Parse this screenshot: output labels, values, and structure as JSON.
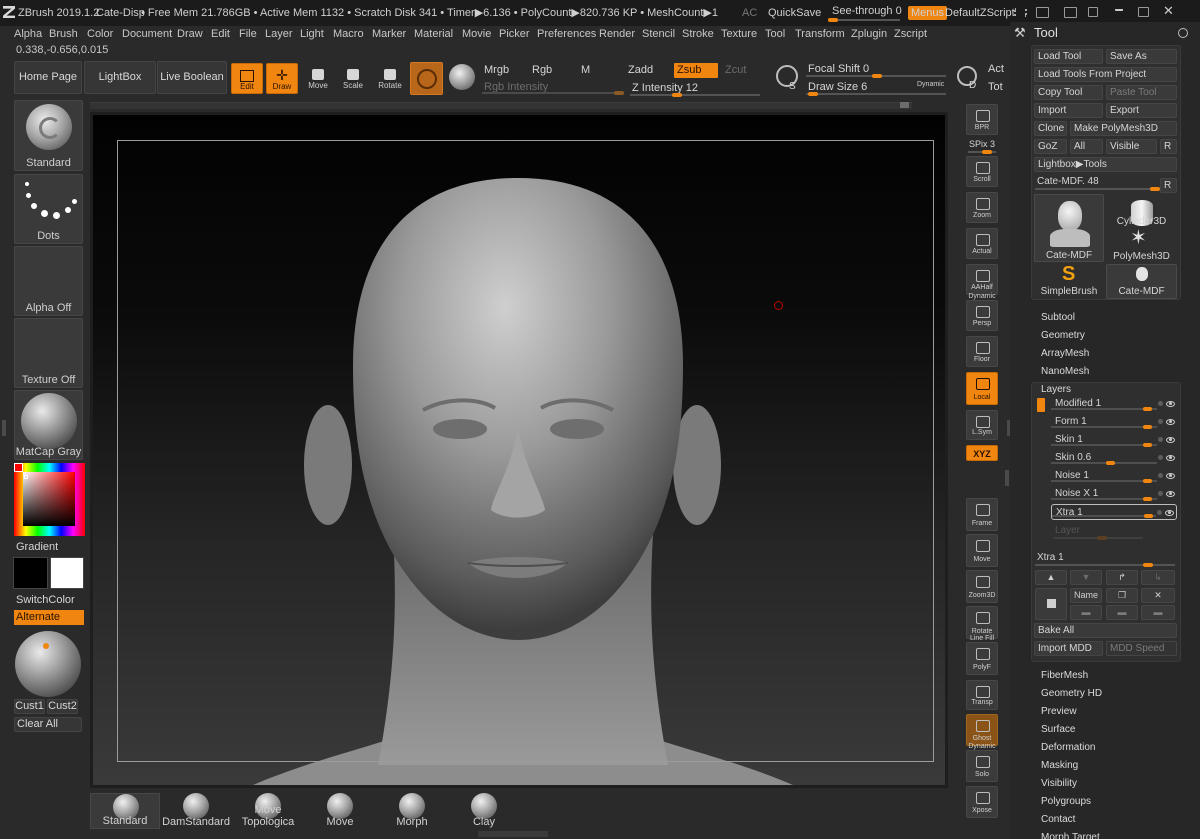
{
  "titlebar": {
    "app": "ZBrush 2019.1.2",
    "document": "Cate-Disp",
    "stats": "• Free Mem 21.786GB • Active Mem 1132 • Scratch Disk 341 • Timer▶6.136 • PolyCount▶820.736 KP • MeshCount▶1",
    "ac": "AC",
    "quicksave": "QuickSave",
    "see_through": "See-through  0",
    "see_through_value": 0,
    "menus": "Menus",
    "script": "DefaultZScript"
  },
  "menubar": [
    "Alpha",
    "Brush",
    "Color",
    "Document",
    "Draw",
    "Edit",
    "File",
    "Layer",
    "Light",
    "Macro",
    "Marker",
    "Material",
    "Movie",
    "Picker",
    "Preferences",
    "Render",
    "Stencil",
    "Stroke",
    "Texture",
    "Tool",
    "Transform",
    "Zplugin",
    "Zscript"
  ],
  "coords": "0.338,-0.656,0.015",
  "topshelf": {
    "home": "Home Page",
    "lightbox": "LightBox",
    "live_boolean": "Live Boolean",
    "edit": "Edit",
    "draw": "Draw",
    "move": "Move",
    "scale": "Scale",
    "rotate": "Rotate",
    "mrgb": "Mrgb",
    "rgb": "Rgb",
    "m": "M",
    "rgb_intensity": "Rgb Intensity",
    "zadd": "Zadd",
    "zsub": "Zsub",
    "zcut": "Zcut",
    "z_intensity": "Z Intensity 12",
    "focal_shift": "Focal Shift 0",
    "draw_size": "Draw Size 6",
    "dynamic": "Dynamic",
    "act": "Act",
    "tot": "Tot",
    "s_letter": "S",
    "d_letter": "D"
  },
  "leftshelf": {
    "brush": "Standard",
    "stroke": "Dots",
    "alpha": "Alpha Off",
    "texture": "Texture Off",
    "material": "MatCap Gray",
    "gradient": "Gradient",
    "switchcolor": "SwitchColor",
    "alternate": "Alternate",
    "cust1": "Cust1",
    "cust2": "Cust2",
    "clearall": "Clear All"
  },
  "rightshelf": [
    {
      "label": "BPR",
      "icon": "bpr-icon"
    },
    {
      "label": "SPix 3",
      "icon": "spix-slider"
    },
    {
      "label": "Scroll",
      "icon": "scroll-icon"
    },
    {
      "label": "Zoom",
      "icon": "zoom-icon"
    },
    {
      "label": "Actual",
      "icon": "actual-icon"
    },
    {
      "label": "AAHalf",
      "icon": "aahalf-icon"
    },
    {
      "label": "Persp",
      "icon": "persp-icon",
      "top": "Dynamic"
    },
    {
      "label": "Floor",
      "icon": "floor-icon"
    },
    {
      "label": "Local",
      "icon": "local-icon"
    },
    {
      "label": "L.Sym",
      "icon": "lsym-icon"
    },
    {
      "label": "XYZ",
      "icon": "xyz-icon"
    },
    {
      "label": "Frame",
      "icon": "frame-icon"
    },
    {
      "label": "Move",
      "icon": "move-icon"
    },
    {
      "label": "Zoom3D",
      "icon": "zoom3d-icon"
    },
    {
      "label": "Rotate",
      "icon": "rotate-icon"
    },
    {
      "label": "PolyF",
      "icon": "polyf-icon",
      "top": "Line Fill"
    },
    {
      "label": "Transp",
      "icon": "transp-icon"
    },
    {
      "label": "Ghost",
      "icon": "ghost-icon"
    },
    {
      "label": "Solo",
      "icon": "solo-icon",
      "top": "Dynamic"
    },
    {
      "label": "Xpose",
      "icon": "xpose-icon"
    }
  ],
  "bottomshelf": [
    "Standard",
    "DamStandard",
    "Move Topologica",
    "Move",
    "Morph",
    "Clay"
  ],
  "toolpanel": {
    "title": "Tool",
    "load_tool": "Load Tool",
    "save_as": "Save As",
    "load_from_project": "Load Tools From Project",
    "copy_tool": "Copy Tool",
    "paste_tool": "Paste Tool",
    "import": "Import",
    "export": "Export",
    "clone": "Clone",
    "make_polymesh": "Make PolyMesh3D",
    "goz": "GoZ",
    "all": "All",
    "visible": "Visible",
    "r": "R",
    "lightbox_tools": "Lightbox▶Tools",
    "current_tool": "Cate-MDF. 48",
    "thumbs": [
      "Cate-MDF",
      "Cylinder3D",
      "PolyMesh3D",
      "SimpleBrush",
      "Cate-MDF"
    ],
    "sections_top": [
      "Subtool",
      "Geometry",
      "ArrayMesh",
      "NanoMesh"
    ],
    "layers_title": "Layers",
    "layers": [
      {
        "name": "Modified 1",
        "value": 1
      },
      {
        "name": "Form 1",
        "value": 1
      },
      {
        "name": "Skin 1",
        "value": 1
      },
      {
        "name": "Skin 0.6",
        "value": 0.6
      },
      {
        "name": "Noise 1",
        "value": 1
      },
      {
        "name": "Noise X 1",
        "value": 1
      },
      {
        "name": "Xtra 1",
        "value": 1
      }
    ],
    "layer_placeholder": "Layer",
    "layer_slider": "Xtra 1",
    "name_btn": "Name",
    "bake_all": "Bake All",
    "import_mdd": "Import MDD",
    "mdd_speed": "MDD Speed",
    "sections_bottom": [
      "FiberMesh",
      "Geometry HD",
      "Preview",
      "Surface",
      "Deformation",
      "Masking",
      "Visibility",
      "Polygroups",
      "Contact",
      "Morph Target"
    ]
  },
  "colors": {
    "accent": "#f0860f",
    "panel": "#272727",
    "canvas": "#000000"
  }
}
